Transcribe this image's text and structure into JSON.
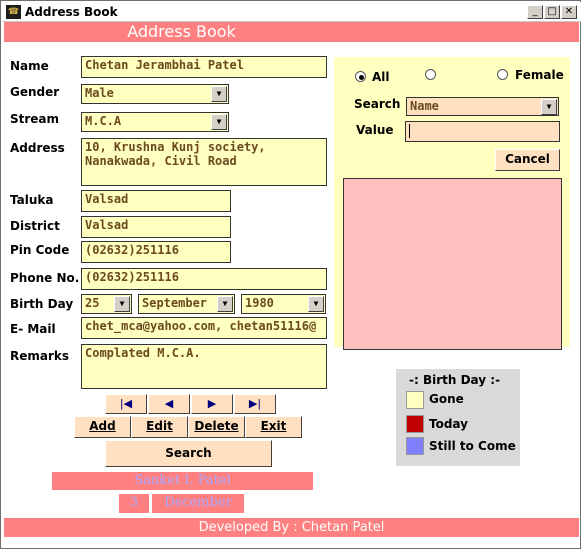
{
  "window": {
    "title": "Address Book",
    "minimize_glyph": "_",
    "maximize_glyph": "□",
    "close_glyph": "✕",
    "icon": "app-icon"
  },
  "header": {
    "title": "Address Book"
  },
  "form": {
    "name_label": "Name",
    "name_value": "Chetan Jerambhai Patel",
    "gender_label": "Gender",
    "gender_value": "Male",
    "stream_label": "Stream",
    "stream_value": "M.C.A",
    "address_label": "Address",
    "address_value": "10, Krushna Kunj society,\nNanakwada, Civil Road",
    "taluka_label": "Taluka",
    "taluka_value": "Valsad",
    "district_label": "District",
    "district_value": "Valsad",
    "pincode_label": "Pin Code",
    "pincode_value": "(02632)251116",
    "phone_label": "Phone No.",
    "phone_value": "(02632)251116",
    "birthday_label": "Birth Day",
    "birth_day": "25",
    "birth_month": "September",
    "birth_year": "1980",
    "email_label": "E- Mail",
    "email_value": "chet_mca@yahoo.com, chetan51116@",
    "remarks_label": "Remarks",
    "remarks_value": "Complated M.C.A."
  },
  "nav": {
    "first": "|◀",
    "prev": "◀",
    "next": "▶",
    "last": "▶|"
  },
  "actions": {
    "add": "Add",
    "edit": "Edit",
    "delete": "Delete",
    "exit": "Exit",
    "search": "Search"
  },
  "search_panel": {
    "radio_all": "All",
    "radio_male": "",
    "radio_female": "Female",
    "search_label": "Search",
    "search_field": "Name",
    "value_label": "Value",
    "value_input": "",
    "cancel": "Cancel"
  },
  "legend": {
    "title": "-: Birth Day :-",
    "gone": "Gone",
    "today": "Today",
    "still": "Still to Come",
    "gone_color": "#ffffc0",
    "today_color": "#c00000",
    "still_color": "#8080ff"
  },
  "birthday_bar": {
    "name": "Sanket I. Patel",
    "day": "3",
    "month": "December"
  },
  "footer": {
    "text": "Developed By : Chetan Patel"
  }
}
